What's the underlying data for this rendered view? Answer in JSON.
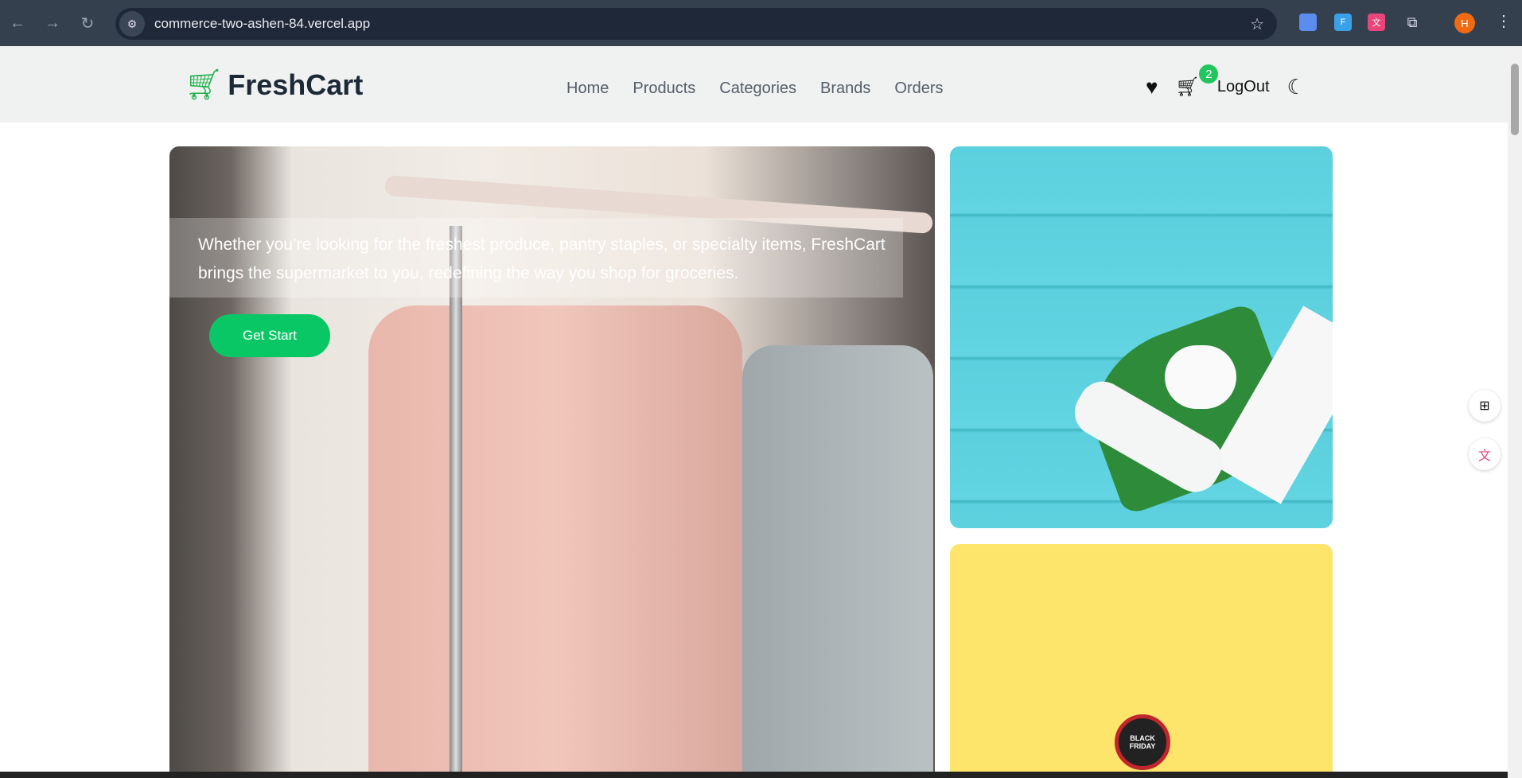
{
  "browser": {
    "url": "commerce-two-ashen-84.vercel.app",
    "profile_initial": "H"
  },
  "header": {
    "brand": "FreshCart",
    "nav": [
      "Home",
      "Products",
      "Categories",
      "Brands",
      "Orders"
    ],
    "cart_count": "2",
    "logout": "LogOut"
  },
  "hero": {
    "text": "Whether you’re looking for the freshest produce, pantry staples, or specialty items, FreshCart brings the supermarket to you, redefining the way you shop for groceries.",
    "button": "Get Start"
  },
  "promo": {
    "clock_text": "BLACK FRIDAY"
  },
  "colors": {
    "accent": "#0ac766",
    "header_bg": "#f0f2f1"
  }
}
